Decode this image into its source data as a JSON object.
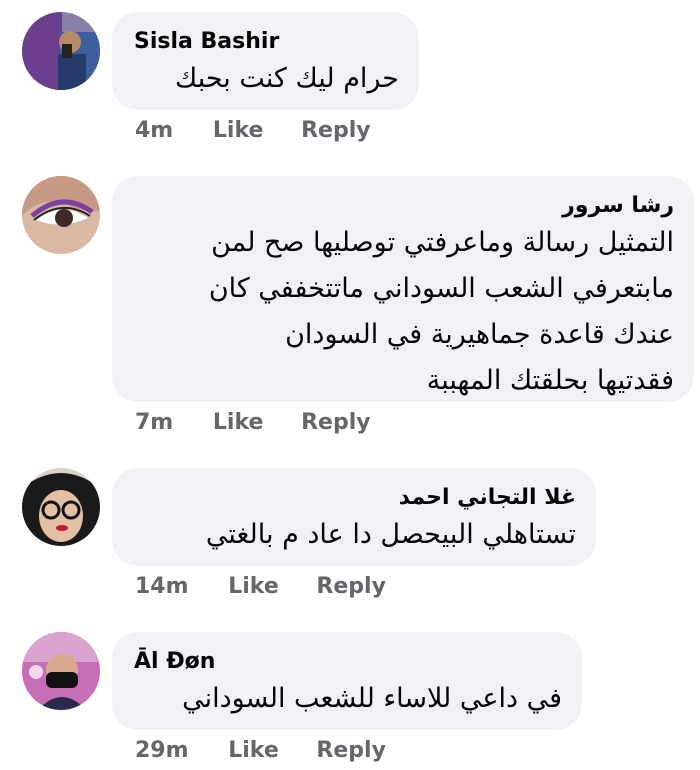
{
  "comments": [
    {
      "author": "Sisla Bashir",
      "text": "حرام ليك كنت بحبك",
      "time": "4m",
      "like_label": "Like",
      "reply_label": "Reply"
    },
    {
      "author": "رشا سرور",
      "text": "التمثيل رسالة وماعرفتي توصليها صح لمن\nمابتعرفي الشعب السوداني ماتتخففي كان\nعندك قاعدة جماهيرية في السودان\nفقدتيها بحلقتك المهببة",
      "time": "7m",
      "like_label": "Like",
      "reply_label": "Reply"
    },
    {
      "author": "غلا التجاني احمد",
      "text": "تستاهلي البيحصل دا عاد م بالغتي",
      "time": "14m",
      "like_label": "Like",
      "reply_label": "Reply"
    },
    {
      "author": "Āl Đøn",
      "text": "في داعي للاساء للشعب السوداني",
      "time": "29m",
      "like_label": "Like",
      "reply_label": "Reply"
    }
  ]
}
